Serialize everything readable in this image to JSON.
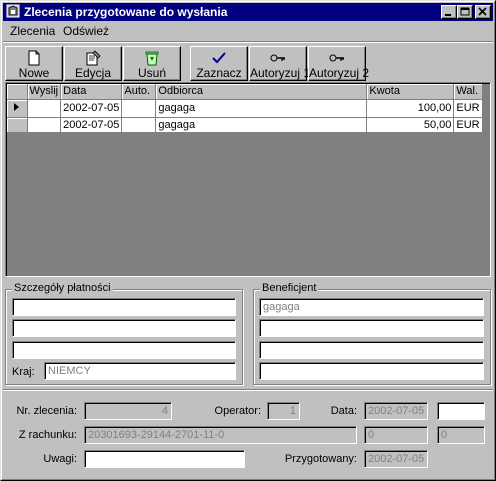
{
  "window": {
    "title": "Zlecenia przygotowane do wysłania"
  },
  "menu": [
    {
      "label": "Zlecenia"
    },
    {
      "label": "Odśwież"
    }
  ],
  "toolbar": {
    "nowe": "Nowe",
    "edycja": "Edycja",
    "usun": "Usuń",
    "zaznacz": "Zaznacz",
    "autoryzuj1": "Autoryzuj 1",
    "autoryzuj2": "Autoryzuj 2"
  },
  "grid": {
    "columns": [
      "Wyslij",
      "Data",
      "Auto.",
      "Odbiorca",
      "Kwota",
      "Wal."
    ],
    "rows": [
      {
        "wyslij": "",
        "data": "2002-07-05",
        "auto": "",
        "odbiorca": "gagaga",
        "kwota": "100,00",
        "wal": "EUR",
        "current": true
      },
      {
        "wyslij": "",
        "data": "2002-07-05",
        "auto": "",
        "odbiorca": "gagaga",
        "kwota": "50,00",
        "wal": "EUR",
        "current": false
      }
    ]
  },
  "szczegoly": {
    "title": "Szczegóły płatności",
    "line1": "",
    "line2": "",
    "line3": "",
    "kraj_label": "Kraj:",
    "kraj_value": "NIEMCY"
  },
  "beneficjent": {
    "title": "Beneficjent",
    "line1": "gagaga",
    "line2": "",
    "line3": "",
    "line4": ""
  },
  "footer": {
    "nr_label": "Nr. zlecenia:",
    "nr_value": "4",
    "operator_label": "Operator:",
    "operator_value": "1",
    "data_label": "Data:",
    "data_value": "2002-07-05",
    "data_extra": "",
    "rachunek_label": "Z rachunku:",
    "rachunek_value": "20301693-29144-2701-11-0",
    "rachunek_extra1": "0",
    "rachunek_extra2": "0",
    "uwagi_label": "Uwagi:",
    "uwagi_value": "",
    "przygotowany_label": "Przygotowany:",
    "przygotowany_value": "2002-07-05"
  }
}
